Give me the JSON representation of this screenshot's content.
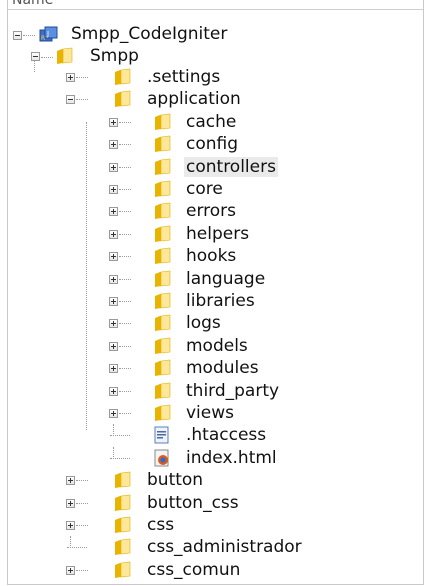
{
  "header": {
    "partial_label": "Name"
  },
  "tree": {
    "project": {
      "label": "Smpp_CodeIgniter",
      "expanded": true,
      "icon": "project-icon"
    },
    "root": {
      "label": "Smpp",
      "expanded": true,
      "icon": "folder-icon"
    },
    "items": [
      {
        "label": ".settings",
        "type": "folder",
        "toggle": "plus",
        "level": 1
      },
      {
        "label": "application",
        "type": "folder",
        "toggle": "minus",
        "level": 1
      },
      {
        "label": "cache",
        "type": "folder",
        "toggle": "plus",
        "level": 2
      },
      {
        "label": "config",
        "type": "folder",
        "toggle": "plus",
        "level": 2
      },
      {
        "label": "controllers",
        "type": "folder",
        "toggle": "plus",
        "level": 2,
        "selected": true
      },
      {
        "label": "core",
        "type": "folder",
        "toggle": "plus",
        "level": 2
      },
      {
        "label": "errors",
        "type": "folder",
        "toggle": "plus",
        "level": 2
      },
      {
        "label": "helpers",
        "type": "folder",
        "toggle": "plus",
        "level": 2
      },
      {
        "label": "hooks",
        "type": "folder",
        "toggle": "plus",
        "level": 2
      },
      {
        "label": "language",
        "type": "folder",
        "toggle": "plus",
        "level": 2
      },
      {
        "label": "libraries",
        "type": "folder",
        "toggle": "plus",
        "level": 2
      },
      {
        "label": "logs",
        "type": "folder",
        "toggle": "plus",
        "level": 2
      },
      {
        "label": "models",
        "type": "folder",
        "toggle": "plus",
        "level": 2
      },
      {
        "label": "modules",
        "type": "folder",
        "toggle": "plus",
        "level": 2
      },
      {
        "label": "third_party",
        "type": "folder",
        "toggle": "plus",
        "level": 2
      },
      {
        "label": "views",
        "type": "folder",
        "toggle": "plus",
        "level": 2
      },
      {
        "label": ".htaccess",
        "type": "file-text",
        "toggle": "none",
        "level": 2
      },
      {
        "label": "index.html",
        "type": "file-html",
        "toggle": "none",
        "level": 2
      },
      {
        "label": "button",
        "type": "folder",
        "toggle": "plus",
        "level": 1
      },
      {
        "label": "button_css",
        "type": "folder",
        "toggle": "plus",
        "level": 1
      },
      {
        "label": "css",
        "type": "folder",
        "toggle": "plus",
        "level": 1
      },
      {
        "label": "css_administrador",
        "type": "folder",
        "toggle": "none",
        "level": 1
      },
      {
        "label": "css_comun",
        "type": "folder",
        "toggle": "plus",
        "level": 1
      }
    ]
  },
  "colors": {
    "folder_light": "#fde79a",
    "folder_dark": "#e8b400",
    "selection": "#eaeaea"
  }
}
